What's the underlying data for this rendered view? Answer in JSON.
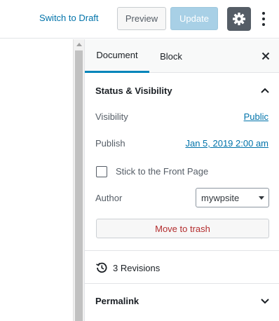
{
  "header": {
    "switch_to_draft": "Switch to Draft",
    "preview_label": "Preview",
    "update_label": "Update",
    "settings_icon": "gear-icon",
    "more_icon": "more-vertical-icon"
  },
  "sidebar": {
    "tabs": [
      {
        "label": "Document",
        "active": true
      },
      {
        "label": "Block",
        "active": false
      }
    ],
    "close_icon": "close-icon",
    "status_panel": {
      "title": "Status & Visibility",
      "expanded": true,
      "visibility_label": "Visibility",
      "visibility_value": "Public",
      "publish_label": "Publish",
      "publish_value": "Jan 5, 2019 2:00 am",
      "sticky_label": "Stick to the Front Page",
      "sticky_checked": false,
      "author_label": "Author",
      "author_value": "mywpsite",
      "trash_label": "Move to trash"
    },
    "revisions": {
      "label": "3 Revisions",
      "icon": "history-icon"
    },
    "permalink": {
      "title": "Permalink",
      "expanded": false
    }
  },
  "colors": {
    "accent": "#0073aa",
    "tab_underline": "#0085ba",
    "update_disabled": "#a8d0e6",
    "trash": "#b32d2e",
    "settings_bg": "#555d66"
  }
}
